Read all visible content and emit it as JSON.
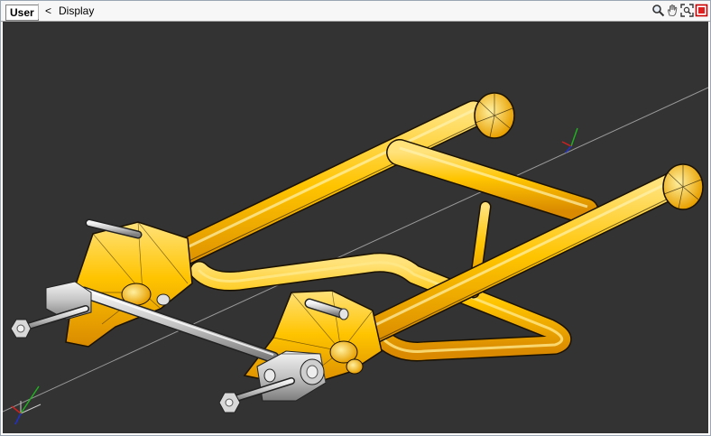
{
  "viewport_toolbar": {
    "view_label": "User",
    "back_glyph": "<",
    "breadcrumb": "Display",
    "tools": [
      {
        "icon": "magnify-icon"
      },
      {
        "icon": "pan-hand-icon"
      },
      {
        "icon": "zoom-extents-icon"
      },
      {
        "icon": "maximize-viewport-icon"
      }
    ]
  },
  "scene": {
    "background_color": "#333333",
    "model_color": "#ffc400",
    "axis_colors": {
      "x": "#d02020",
      "y": "#20b020",
      "z": "#2030d0"
    }
  }
}
